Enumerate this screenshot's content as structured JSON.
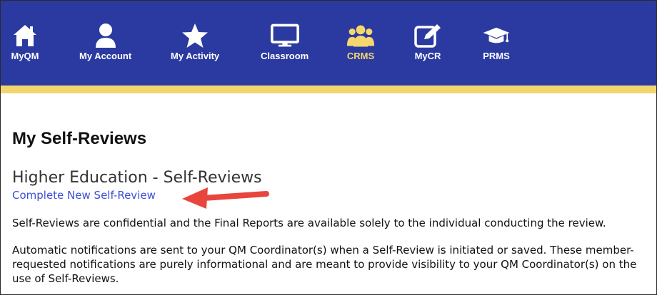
{
  "nav": {
    "items": [
      {
        "label": "MyQM",
        "icon": "home-icon"
      },
      {
        "label": "My Account",
        "icon": "user-icon"
      },
      {
        "label": "My Activity",
        "icon": "star-icon"
      },
      {
        "label": "Classroom",
        "icon": "monitor-icon"
      },
      {
        "label": "CRMS",
        "icon": "group-icon",
        "active": true
      },
      {
        "label": "MyCR",
        "icon": "edit-icon"
      },
      {
        "label": "PRMS",
        "icon": "graduation-cap-icon"
      }
    ],
    "colors": {
      "background": "#2a3aa0",
      "accent_bar": "#f2d66d",
      "active": "#f5d76e"
    }
  },
  "page": {
    "title": "My Self-Reviews",
    "section_title": "Higher Education - Self-Reviews",
    "link_label": "Complete New Self-Review",
    "paragraph1": "Self-Reviews are confidential and the Final Reports are available solely to the individual conducting the review.",
    "paragraph2": "Automatic notifications are sent to your QM Coordinator(s) when a Self-Review is initiated or saved. These member-requested notifications are purely informational and are meant to provide visibility to your QM Coordinator(s) on the use of Self-Reviews."
  },
  "annotation": {
    "arrow_color": "#e8453c"
  }
}
